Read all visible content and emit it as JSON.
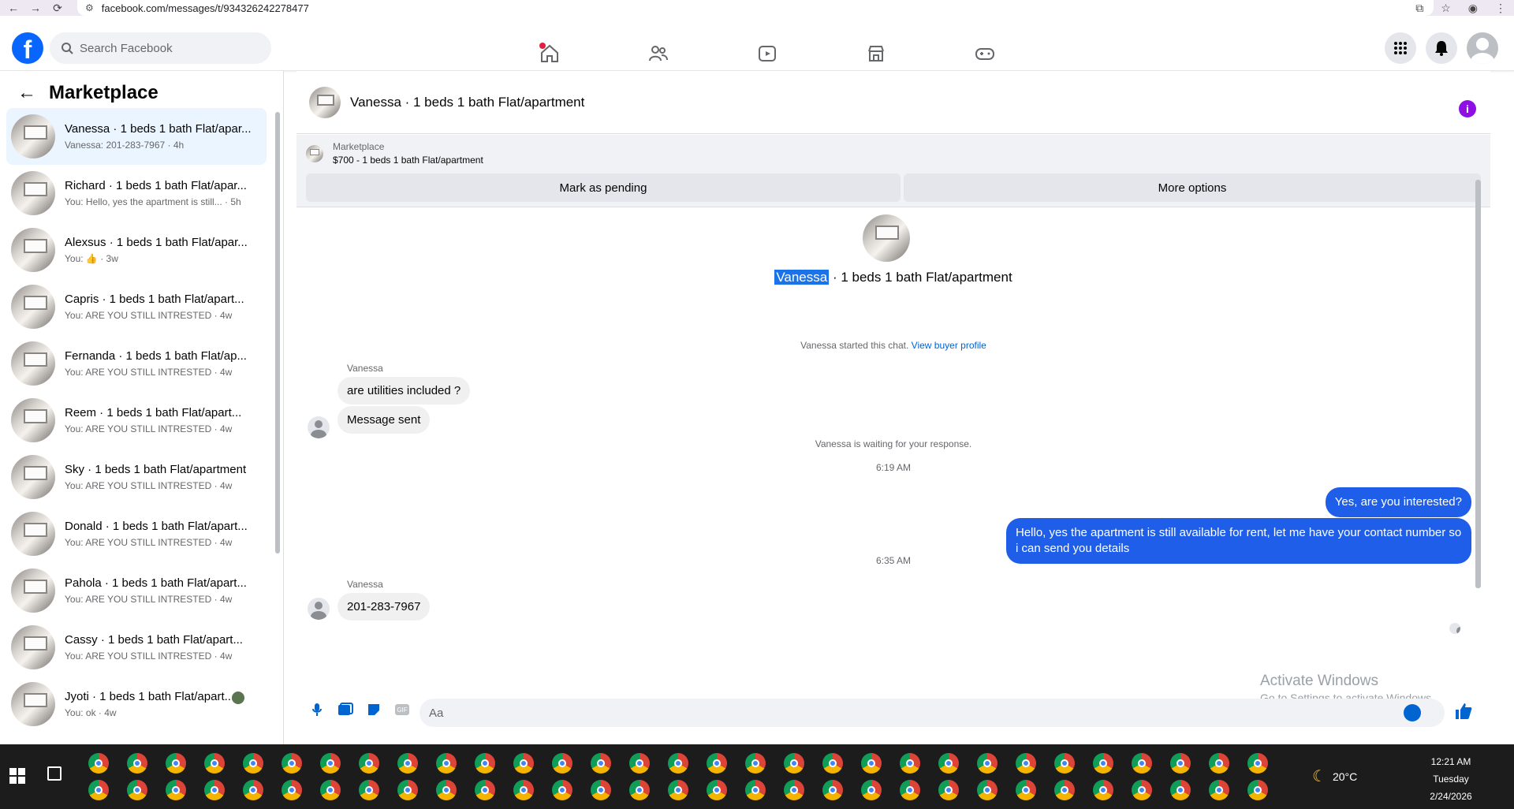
{
  "browser": {
    "url": "facebook.com/messages/t/934326242278477"
  },
  "header": {
    "logo_letter": "f",
    "search_placeholder": "Search Facebook",
    "nav_items": [
      "home-icon",
      "friends-icon",
      "video-icon",
      "marketplace-icon",
      "gaming-icon"
    ]
  },
  "sidebar": {
    "title": "Marketplace",
    "conversations": [
      {
        "name": "Vanessa · 1 beds 1 bath Flat/apar...",
        "preview": "Vanessa: 201-283-7967 · 4h",
        "active": true
      },
      {
        "name": "Richard · 1 beds 1 bath Flat/apar...",
        "preview": "You: Hello, yes the apartment is still... · 5h"
      },
      {
        "name": "Alexsus · 1 beds 1 bath Flat/apar...",
        "preview": "You: 👍 · 3w"
      },
      {
        "name": "Capris · 1 beds 1 bath Flat/apart...",
        "preview": "You: ARE YOU STILL INTRESTED · 4w"
      },
      {
        "name": "Fernanda · 1 beds 1 bath Flat/ap...",
        "preview": "You: ARE YOU STILL INTRESTED · 4w"
      },
      {
        "name": "Reem · 1 beds 1 bath Flat/apart...",
        "preview": "You: ARE YOU STILL INTRESTED · 4w"
      },
      {
        "name": "Sky · 1 beds 1 bath Flat/apartment",
        "preview": "You: ARE YOU STILL INTRESTED · 4w"
      },
      {
        "name": "Donald · 1 beds 1 bath Flat/apart...",
        "preview": "You: ARE YOU STILL INTRESTED · 4w"
      },
      {
        "name": "Pahola · 1 beds 1 bath Flat/apart...",
        "preview": "You: ARE YOU STILL INTRESTED · 4w"
      },
      {
        "name": "Cassy · 1 beds 1 bath Flat/apart...",
        "preview": "You: ARE YOU STILL INTRESTED · 4w"
      },
      {
        "name": "Jyoti · 1 beds 1 bath Flat/apart...",
        "preview": "You: ok · 4w"
      }
    ]
  },
  "chat": {
    "title": "Vanessa · 1 beds 1 bath Flat/apartment",
    "listing": {
      "label": "Marketplace",
      "price_title": "$700 - 1 beds 1 bath Flat/apartment",
      "mark_pending": "Mark as pending",
      "more_options": "More options"
    },
    "center_name": "Vanessa",
    "center_rest": " · 1 beds 1 bath Flat/apartment",
    "started_note": "Vanessa started this chat.",
    "view_profile": "View buyer profile",
    "sender_name": "Vanessa",
    "msg1": "are utilities included ?",
    "msg2": "Message sent",
    "waiting_note": "Vanessa is waiting for your response.",
    "time1": "6:19 AM",
    "out1": "Yes, are you interested?",
    "out2": "Hello, yes the apartment is still available for rent, let me have your contact number so i can send you details",
    "time2": "6:35 AM",
    "msg3": "201-283-7967",
    "composer_placeholder": "Aa"
  },
  "watermark": {
    "title": "Activate Windows",
    "subtitle": "Go to Settings to activate Windows."
  },
  "taskbar": {
    "temperature": "20°C",
    "time": "12:21 AM",
    "day": "Tuesday",
    "date": "2/24/2026"
  }
}
